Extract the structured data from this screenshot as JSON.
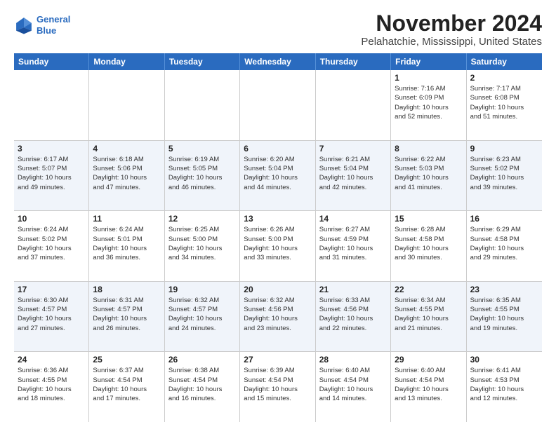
{
  "header": {
    "logo_line1": "General",
    "logo_line2": "Blue",
    "title": "November 2024",
    "subtitle": "Pelahatchie, Mississippi, United States"
  },
  "days_of_week": [
    "Sunday",
    "Monday",
    "Tuesday",
    "Wednesday",
    "Thursday",
    "Friday",
    "Saturday"
  ],
  "weeks": [
    {
      "alt": false,
      "cells": [
        {
          "day": "",
          "info": ""
        },
        {
          "day": "",
          "info": ""
        },
        {
          "day": "",
          "info": ""
        },
        {
          "day": "",
          "info": ""
        },
        {
          "day": "",
          "info": ""
        },
        {
          "day": "1",
          "info": "Sunrise: 7:16 AM\nSunset: 6:09 PM\nDaylight: 10 hours\nand 52 minutes."
        },
        {
          "day": "2",
          "info": "Sunrise: 7:17 AM\nSunset: 6:08 PM\nDaylight: 10 hours\nand 51 minutes."
        }
      ]
    },
    {
      "alt": true,
      "cells": [
        {
          "day": "3",
          "info": "Sunrise: 6:17 AM\nSunset: 5:07 PM\nDaylight: 10 hours\nand 49 minutes."
        },
        {
          "day": "4",
          "info": "Sunrise: 6:18 AM\nSunset: 5:06 PM\nDaylight: 10 hours\nand 47 minutes."
        },
        {
          "day": "5",
          "info": "Sunrise: 6:19 AM\nSunset: 5:05 PM\nDaylight: 10 hours\nand 46 minutes."
        },
        {
          "day": "6",
          "info": "Sunrise: 6:20 AM\nSunset: 5:04 PM\nDaylight: 10 hours\nand 44 minutes."
        },
        {
          "day": "7",
          "info": "Sunrise: 6:21 AM\nSunset: 5:04 PM\nDaylight: 10 hours\nand 42 minutes."
        },
        {
          "day": "8",
          "info": "Sunrise: 6:22 AM\nSunset: 5:03 PM\nDaylight: 10 hours\nand 41 minutes."
        },
        {
          "day": "9",
          "info": "Sunrise: 6:23 AM\nSunset: 5:02 PM\nDaylight: 10 hours\nand 39 minutes."
        }
      ]
    },
    {
      "alt": false,
      "cells": [
        {
          "day": "10",
          "info": "Sunrise: 6:24 AM\nSunset: 5:02 PM\nDaylight: 10 hours\nand 37 minutes."
        },
        {
          "day": "11",
          "info": "Sunrise: 6:24 AM\nSunset: 5:01 PM\nDaylight: 10 hours\nand 36 minutes."
        },
        {
          "day": "12",
          "info": "Sunrise: 6:25 AM\nSunset: 5:00 PM\nDaylight: 10 hours\nand 34 minutes."
        },
        {
          "day": "13",
          "info": "Sunrise: 6:26 AM\nSunset: 5:00 PM\nDaylight: 10 hours\nand 33 minutes."
        },
        {
          "day": "14",
          "info": "Sunrise: 6:27 AM\nSunset: 4:59 PM\nDaylight: 10 hours\nand 31 minutes."
        },
        {
          "day": "15",
          "info": "Sunrise: 6:28 AM\nSunset: 4:58 PM\nDaylight: 10 hours\nand 30 minutes."
        },
        {
          "day": "16",
          "info": "Sunrise: 6:29 AM\nSunset: 4:58 PM\nDaylight: 10 hours\nand 29 minutes."
        }
      ]
    },
    {
      "alt": true,
      "cells": [
        {
          "day": "17",
          "info": "Sunrise: 6:30 AM\nSunset: 4:57 PM\nDaylight: 10 hours\nand 27 minutes."
        },
        {
          "day": "18",
          "info": "Sunrise: 6:31 AM\nSunset: 4:57 PM\nDaylight: 10 hours\nand 26 minutes."
        },
        {
          "day": "19",
          "info": "Sunrise: 6:32 AM\nSunset: 4:57 PM\nDaylight: 10 hours\nand 24 minutes."
        },
        {
          "day": "20",
          "info": "Sunrise: 6:32 AM\nSunset: 4:56 PM\nDaylight: 10 hours\nand 23 minutes."
        },
        {
          "day": "21",
          "info": "Sunrise: 6:33 AM\nSunset: 4:56 PM\nDaylight: 10 hours\nand 22 minutes."
        },
        {
          "day": "22",
          "info": "Sunrise: 6:34 AM\nSunset: 4:55 PM\nDaylight: 10 hours\nand 21 minutes."
        },
        {
          "day": "23",
          "info": "Sunrise: 6:35 AM\nSunset: 4:55 PM\nDaylight: 10 hours\nand 19 minutes."
        }
      ]
    },
    {
      "alt": false,
      "cells": [
        {
          "day": "24",
          "info": "Sunrise: 6:36 AM\nSunset: 4:55 PM\nDaylight: 10 hours\nand 18 minutes."
        },
        {
          "day": "25",
          "info": "Sunrise: 6:37 AM\nSunset: 4:54 PM\nDaylight: 10 hours\nand 17 minutes."
        },
        {
          "day": "26",
          "info": "Sunrise: 6:38 AM\nSunset: 4:54 PM\nDaylight: 10 hours\nand 16 minutes."
        },
        {
          "day": "27",
          "info": "Sunrise: 6:39 AM\nSunset: 4:54 PM\nDaylight: 10 hours\nand 15 minutes."
        },
        {
          "day": "28",
          "info": "Sunrise: 6:40 AM\nSunset: 4:54 PM\nDaylight: 10 hours\nand 14 minutes."
        },
        {
          "day": "29",
          "info": "Sunrise: 6:40 AM\nSunset: 4:54 PM\nDaylight: 10 hours\nand 13 minutes."
        },
        {
          "day": "30",
          "info": "Sunrise: 6:41 AM\nSunset: 4:53 PM\nDaylight: 10 hours\nand 12 minutes."
        }
      ]
    }
  ]
}
